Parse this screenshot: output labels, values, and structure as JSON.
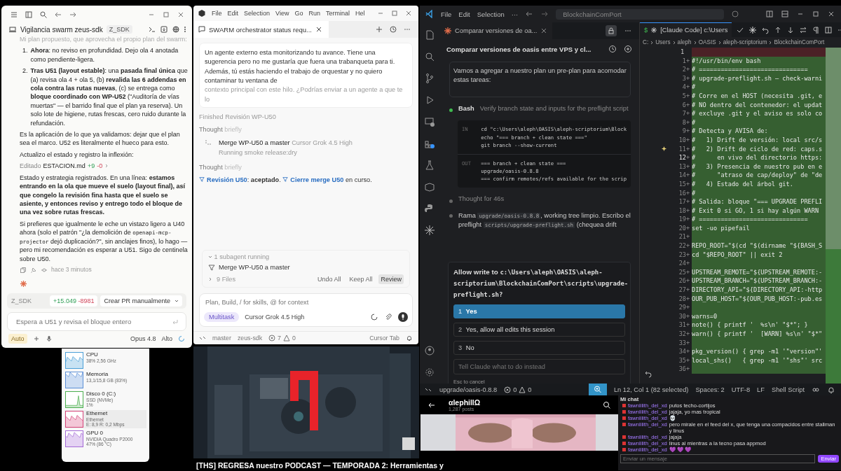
{
  "left_window": {
    "title": "Vigilancia swarm zeus-sdk",
    "badge": "Z_SDK",
    "faded_line": "Mi plan propuesto, que aprovecha el propio plan del swarm:",
    "list": [
      {
        "n": "1.",
        "text": "**Ahora**: no reviso en profundidad. Dejo ola 4 anotada como pendiente-ligera."
      },
      {
        "n": "2.",
        "text": "**Tras U51 (layout estable)**: una **pasada final única** que (a) revisa ola 4 + ola 5, (b) **revalida las 6 addendas en cola contra las rutas nuevas**, (c) se entrega como **bloque coordinado con WP-U52** (\"Auditoría de vías muertas\" — el barrido final que el plan ya reserva). Un solo lote de higiene, rutas frescas, cero ruido durante la refundación."
      }
    ],
    "para_1": "Es la aplicación de lo que ya validamos: dejar que el plan sea el marco. U52 es literalmente el hueco para esto.",
    "para_2": "Actualizo el estado y registro la inflexión:",
    "edit": {
      "verb": "Editado",
      "file": "ESTACION.md",
      "added": "+9",
      "removed": "-0"
    },
    "para_3": "Estado y estrategia registrados. En una línea: **estamos entrando en la ola que mueve el suelo (layout final), así que congelo la revisión fina hasta que el suelo se asiente, y entonces reviso y entrego todo el bloque de una vez sobre rutas frescas.**",
    "para_4": [
      {
        "t": "Si prefieres que igualmente le eche un vistazo ligero a U40 ahora (solo el patrón \"¿la demolición de "
      },
      {
        "code": "openapi-mcp-projector"
      },
      {
        "t": " dejó duplicación?\", sin anclajes finos), lo hago — pero mi recomendación es esperar a U51. Sigo de centinela sobre U50."
      }
    ],
    "time": "hace 3 minutos",
    "branch": {
      "name": "Z_SDK",
      "added": "+15.049",
      "removed": "-8981",
      "action": "Crear PR manualmente"
    },
    "input": {
      "placeholder": "Espera a U51 y revisa el bloque entero"
    },
    "mode": "Auto",
    "model": "Opus 4.8",
    "effort": "Alto"
  },
  "middle_window": {
    "menu": [
      "File",
      "Edit",
      "Selection",
      "View",
      "Go",
      "Run",
      "Terminal",
      "Hel"
    ],
    "tab": "SWARM orchestrator status requ...",
    "message": "Un agente externo esta monitorizando tu avance. Tiene una sugerencia pero no me gustaría que fuera una trabanqueta para ti. Además, tú estás haciendo el trabajo de orquestar y no quiero contaminar tu ventana de",
    "message_faded": "contexto principal con este hilo. ¿Podrías enviar a un agente a que te lo",
    "finished": "Finished Revisión WP-U50",
    "thought_1": {
      "label": "Thought",
      "detail": "briefly"
    },
    "task": {
      "title": "Merge WP-U50 a master",
      "model": "Cursor Grok 4.5 High",
      "status": "Running smoke release:dry"
    },
    "thought_2": {
      "label": "Thought",
      "detail": "briefly"
    },
    "result": [
      {
        "link": "Revisión U50"
      },
      {
        "t": ": "
      },
      {
        "b": "aceptado"
      },
      {
        "t": ". "
      },
      {
        "link": "Cierre merge U50"
      },
      {
        "t": " en curso."
      }
    ],
    "subagents": {
      "header": "1 subagent running",
      "item": "Merge WP-U50 a master",
      "files": "9 Files",
      "buttons": [
        "Undo All",
        "Keep All",
        "Review"
      ]
    },
    "input": {
      "placeholder": "Plan, Build, / for skills, @ for context"
    },
    "mode": "Multitask",
    "model": "Cursor Grok 4.5 High",
    "status_bar": {
      "branch": "master",
      "project": "zeus-sdk",
      "errors": "7",
      "warnings": "0",
      "right": "Cursor Tab"
    }
  },
  "vscode": {
    "menu": [
      "File",
      "Edit",
      "Selection",
      "···"
    ],
    "search": "BlockchainComPort",
    "chat_tab": "Comparar versiones de oa...",
    "chat_title": "Comparar versiones de oasis entre VPS y cl...",
    "message": "Vamos a agregar a nuestro plan un pre-plan para acomodar estas tareas:",
    "bash": {
      "tool": "Bash",
      "description": "Verify branch state and inputs for the preflight script",
      "in_label": "IN",
      "in": [
        "cd \"c:\\Users\\aleph\\OASIS\\aleph-scriptorium\\Block",
        "echo \"=== branch + clean state ===\"",
        "git branch --show-current"
      ],
      "out_label": "OUT",
      "out": [
        "=== branch + clean state ===",
        "upgrade/oasis-0.8.8",
        "=== confirm remotes/refs available for the scrip"
      ]
    },
    "thought": "Thought for 46s",
    "reply": [
      {
        "t": "Rama "
      },
      {
        "code": "upgrade/oasis-0.8.8"
      },
      {
        "t": ", working tree limpio. Escribo el preflight "
      },
      {
        "code": "scripts/upgrade-preflight.sh"
      },
      {
        "t": " (chequea drift"
      }
    ],
    "dialog": {
      "question": "Allow write to ",
      "path": "c:\\Users\\aleph\\OASIS\\aleph-scriptorium\\BlockchainComPort\\scripts\\upgrade-preflight.sh?",
      "options": [
        {
          "n": "1",
          "label": "Yes",
          "selected": true
        },
        {
          "n": "2",
          "label": "Yes, allow all edits this session",
          "selected": false
        },
        {
          "n": "3",
          "label": "No",
          "selected": false
        }
      ],
      "placeholder": "Tell Claude what to do instead",
      "hint": "Esc to cancel"
    },
    "editor_tab": {
      "icon": "$",
      "label": "[Claude Code] c:\\Users"
    },
    "breadcrumbs": [
      "C:",
      "Users",
      "aleph",
      "OASIS",
      "aleph-scriptorium",
      "BlockchainComPort"
    ],
    "deleted_line": "1",
    "lines": [
      {
        "n": "1",
        "sign": "+",
        "text": "#!/usr/bin/env bash"
      },
      {
        "n": "2",
        "sign": "+",
        "text": "# =============================="
      },
      {
        "n": "3",
        "sign": "+",
        "text": "# upgrade-preflight.sh — check-warni"
      },
      {
        "n": "4",
        "sign": "+",
        "text": "#"
      },
      {
        "n": "5",
        "sign": "+",
        "text": "# Corre en el HOST (necesita .git, e"
      },
      {
        "n": "6",
        "sign": "+",
        "text": "# NO dentro del contenedor: el updat"
      },
      {
        "n": "7",
        "sign": "+",
        "text": "# excluye .git y el aviso es solo co"
      },
      {
        "n": "8",
        "sign": "+",
        "text": "#"
      },
      {
        "n": "9",
        "sign": "+",
        "text": "# Detecta y AVISA de:"
      },
      {
        "n": "10",
        "sign": "+",
        "text": "#   1) Drift de versión: local src/s"
      },
      {
        "n": "11",
        "sign": "+",
        "text": "#   2) Drift de ciclo de red: caps.s"
      },
      {
        "n": "12",
        "sign": "+",
        "text": "#      en vivo del directorio https:"
      },
      {
        "n": "13",
        "sign": "+",
        "text": "#   3) Presencia de nuestro pub en e"
      },
      {
        "n": "14",
        "sign": "+",
        "text": "#      \"atraso de cap/deploy\" de \"de"
      },
      {
        "n": "15",
        "sign": "+",
        "text": "#   4) Estado del árbol git."
      },
      {
        "n": "16",
        "sign": "+",
        "text": "#"
      },
      {
        "n": "17",
        "sign": "+",
        "text": "# Salida: bloque \"=== UPGRADE PREFLI"
      },
      {
        "n": "18",
        "sign": "+",
        "text": "# Exit 0 si GO, 1 si hay algún WARN"
      },
      {
        "n": "19",
        "sign": "+",
        "text": "# =============================="
      },
      {
        "n": "20",
        "sign": "+",
        "text": "set -uo pipefail"
      },
      {
        "n": "21",
        "sign": "+"
      },
      {
        "n": "22",
        "sign": "+",
        "text": "REPO_ROOT=\"$(cd \"$(dirname \"${BASH_S"
      },
      {
        "n": "23",
        "sign": "+",
        "text": "cd \"$REPO_ROOT\" || exit 2"
      },
      {
        "n": "24",
        "sign": "+"
      },
      {
        "n": "25",
        "sign": "+",
        "text": "UPSTREAM_REMOTE=\"${UPSTREAM_REMOTE:-"
      },
      {
        "n": "26",
        "sign": "+",
        "text": "UPSTREAM_BRANCH=\"${UPSTREAM_BRANCH:-"
      },
      {
        "n": "27",
        "sign": "+",
        "text": "DIRECTORY_API=\"${DIRECTORY_API:-http"
      },
      {
        "n": "28",
        "sign": "+",
        "text": "OUR_PUB_HOST=\"${OUR_PUB_HOST:-pub.es"
      },
      {
        "n": "29",
        "sign": "+"
      },
      {
        "n": "30",
        "sign": "+",
        "text": "warns=0"
      },
      {
        "n": "31",
        "sign": "+",
        "text": "note() { printf '  %s\\n' \"$*\"; }"
      },
      {
        "n": "32",
        "sign": "+",
        "text": "warn() { printf '  [WARN] %s\\n' \"$*\""
      },
      {
        "n": "33",
        "sign": "+"
      },
      {
        "n": "34",
        "sign": "+",
        "text": "pkg_version() { grep -m1 '\"version\"'"
      },
      {
        "n": "35",
        "sign": "+",
        "text": "local_shs()   { grep -m1 '\"shs\"' src"
      },
      {
        "n": "36",
        "sign": "+"
      }
    ],
    "status_bar": {
      "branch": "upgrade/oasis-0.8.8",
      "errors": "0",
      "warnings": "0",
      "position": "Ln 12, Col 1 (82 selected)",
      "spaces": "Spaces: 2",
      "encoding": "UTF-8",
      "eol": "LF",
      "language": "Shell Script"
    }
  },
  "task_manager": {
    "items": [
      {
        "name": "CPU",
        "detail": [
          "38% 2,56 GHz"
        ],
        "color": "#4a9fd8",
        "selected": false
      },
      {
        "name": "Memoria",
        "detail": [
          "13,1/15,8 GB (83%)"
        ],
        "color": "#5b8fd6",
        "selected": false
      },
      {
        "name": "Disco 0 (C:)",
        "detail": [
          "SSD (NVMe)",
          "1%"
        ],
        "color": "#4caf50",
        "selected": false
      },
      {
        "name": "Ethernet",
        "detail": [
          "Ethernet",
          "E: 8,9 R: 0,2 Mbps"
        ],
        "color": "#d6457a",
        "selected": true
      },
      {
        "name": "GPU 0",
        "detail": [
          "NVIDIA Quadro P2000",
          "47% (86 °C)"
        ],
        "color": "#a46ad6",
        "selected": false
      }
    ]
  },
  "video": {
    "kind": "picture",
    "title": "[THS] REGRESA nuestro PODCAST — TEMPORADA 2: Herramientas y"
  },
  "profile": {
    "name": "αlephillΩ",
    "posts": "1,287 posts"
  },
  "chat": {
    "title": "Mi chat",
    "messages": [
      {
        "user": "fawnlilith_del_xd",
        "text": "putos techo-cortijos"
      },
      {
        "user": "fawnlilith_del_xd",
        "text": "jajaja, yo mas tropical"
      },
      {
        "user": "fawnlilith_del_xd",
        "text": "💀"
      },
      {
        "user": "fawnlilith_del_xd",
        "text": "pero mirale en el feed del x, que tenga una compacidos entre stallman y linus"
      },
      {
        "user": "fawnlilith_del_xd",
        "text": "jajaja"
      },
      {
        "user": "fawnlilith_del_xd",
        "text": "linus al mientras a la tecno pasa appmod"
      },
      {
        "user": "fawnlilith_del_xd",
        "text": "💜 💜 💜"
      }
    ],
    "placeholder": "Enviar un mensaje",
    "send": "Enviar"
  }
}
